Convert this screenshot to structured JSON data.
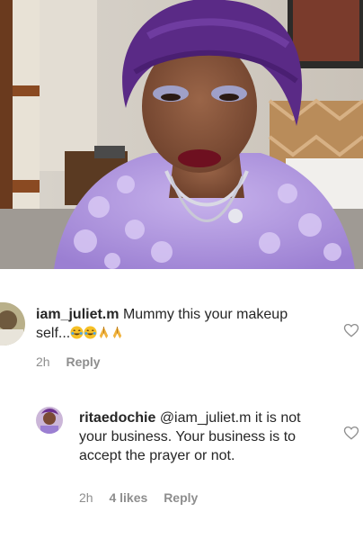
{
  "post": {
    "photo_alt": "woman in purple headwrap and lilac floral lace outfit"
  },
  "comments": [
    {
      "username": "iam_juliet.m",
      "text": "Mummy this your makeup self...",
      "emojis": [
        "face-with-tears-of-joy",
        "face-with-tears-of-joy",
        "folded-hands",
        "folded-hands"
      ],
      "time": "2h",
      "reply_label": "Reply"
    },
    {
      "username": "ritaedochie",
      "mention": "@iam_juliet.m",
      "text": "it is not your business. Your business is to accept the prayer or not.",
      "time": "2h",
      "likes": "4 likes",
      "reply_label": "Reply"
    }
  ],
  "colors": {
    "text": "#262626",
    "meta": "#8e8e8e",
    "purple": "#5a2a86",
    "lilac": "#b79be0"
  }
}
